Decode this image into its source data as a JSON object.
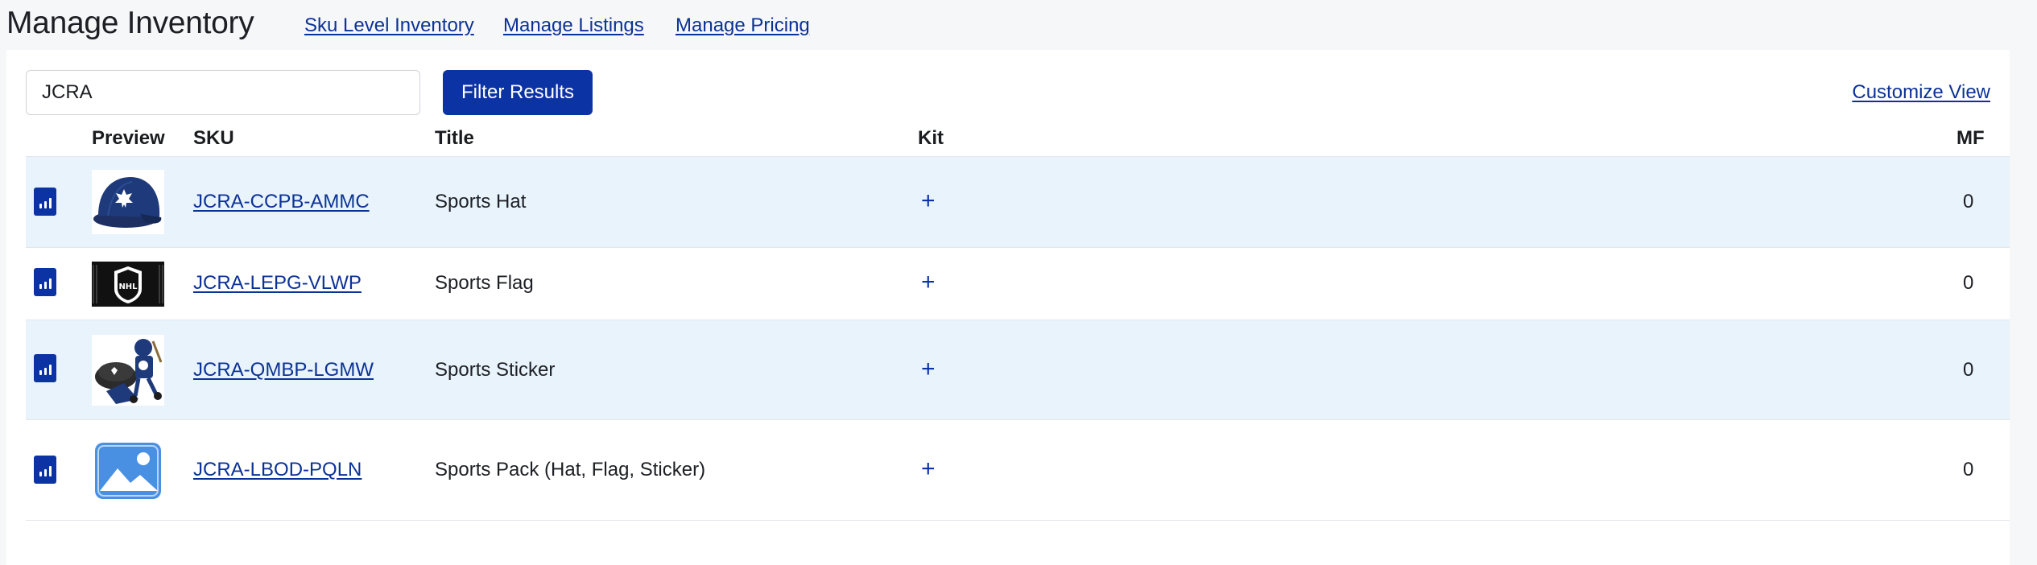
{
  "header": {
    "title": "Manage Inventory",
    "links": [
      "Sku Level Inventory",
      "Manage Listings",
      "Manage Pricing"
    ]
  },
  "toolbar": {
    "search_value": "JCRA",
    "filter_label": "Filter Results",
    "customize_label": "Customize View"
  },
  "table": {
    "columns": {
      "preview": "Preview",
      "sku": "SKU",
      "title": "Title",
      "kit": "Kit",
      "mf": "MF"
    },
    "rows": [
      {
        "sku": "JCRA-CCPB-AMMC",
        "title": "Sports Hat",
        "kit": "+",
        "mf": "0",
        "preview": "hat-image"
      },
      {
        "sku": "JCRA-LEPG-VLWP",
        "title": "Sports Flag",
        "kit": "+",
        "mf": "0",
        "preview": "flag-image"
      },
      {
        "sku": "JCRA-QMBP-LGMW",
        "title": "Sports Sticker",
        "kit": "+",
        "mf": "0",
        "preview": "sticker-image"
      },
      {
        "sku": "JCRA-LBOD-PQLN",
        "title": "Sports Pack (Hat, Flag, Sticker)",
        "kit": "+",
        "mf": "0",
        "preview": "image-placeholder-icon"
      }
    ]
  },
  "colors": {
    "accent": "#0b33a4",
    "link": "#0b3296",
    "row_shade": "#e8f3fc"
  }
}
